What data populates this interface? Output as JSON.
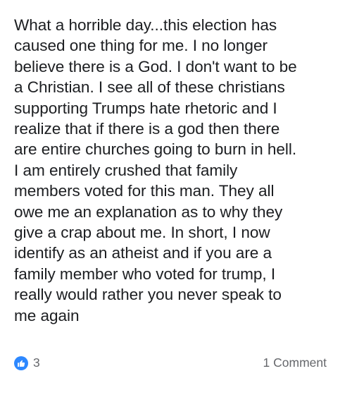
{
  "post": {
    "text_lines": [
      "What a horrible day...this election has",
      "caused one thing for me. I no longer",
      "believe there is a God. I don't want to be",
      "a Christian. I see all of these christians",
      "supporting Trumps hate rhetoric and I",
      "realize that if there is a god then there",
      "are entire churches going to burn in hell.",
      "I am entirely crushed that family",
      "members voted for this man. They all",
      "owe me an explanation as to why they",
      "give a crap about me. In short, I now",
      "identify as an atheist and if you are a",
      "family member who voted for trump, I",
      "really would rather you never speak to",
      "me again"
    ]
  },
  "footer": {
    "reaction_icon": "thumbs-up-icon",
    "reaction_count": "3",
    "comment_label": "1 Comment"
  },
  "colors": {
    "like_blue": "#2d88ff",
    "text_primary": "#1c1e21",
    "text_secondary": "#65676b"
  }
}
